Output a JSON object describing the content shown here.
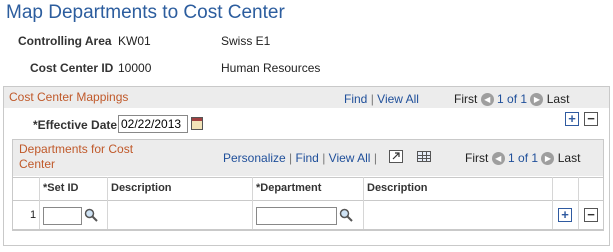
{
  "page": {
    "title": "Map Departments to Cost Center"
  },
  "header": {
    "controlling_area_label": "Controlling Area",
    "controlling_area_code": "KW01",
    "controlling_area_desc": "Swiss E1",
    "cost_center_label": "Cost Center ID",
    "cost_center_code": "10000",
    "cost_center_desc": "Human Resources"
  },
  "mappings": {
    "title": "Cost Center Mappings",
    "find": "Find",
    "view_all": "View All",
    "first": "First",
    "range": "1 of 1",
    "last": "Last",
    "eff_date_label": "*Effective Date",
    "eff_date_value": "02/22/2013"
  },
  "grid": {
    "title": "Departments for Cost Center",
    "personalize": "Personalize",
    "find": "Find",
    "view_all": "View All",
    "first": "First",
    "range": "1 of 1",
    "last": "Last",
    "columns": [
      "*Set ID",
      "Description",
      "*Department",
      "Description"
    ],
    "rows": [
      {
        "num": "1",
        "setid": "",
        "setid_desc": "",
        "dept": "",
        "dept_desc": ""
      }
    ]
  },
  "icons": {
    "prev": "left-arrow-icon",
    "next": "right-arrow-icon",
    "calendar": "calendar-icon",
    "lookup": "magnifier-icon",
    "zoom": "zoom-icon",
    "download": "grid-download-icon"
  },
  "colors": {
    "title": "#2c5d9e",
    "section_title": "#c0592a",
    "link": "#1f4f9a"
  }
}
